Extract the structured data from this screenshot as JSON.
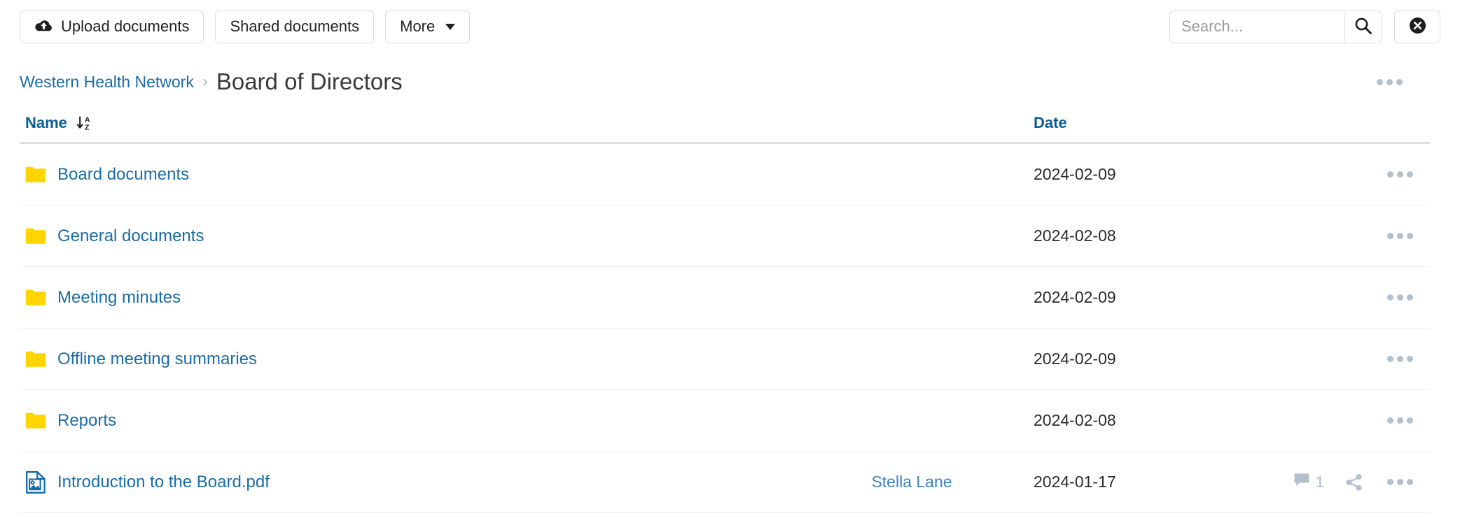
{
  "toolbar": {
    "upload_label": "Upload documents",
    "shared_label": "Shared documents",
    "more_label": "More",
    "upload_icon": "cloud-upload-icon",
    "caret_icon": "caret-down-icon"
  },
  "search": {
    "placeholder": "Search...",
    "value": "",
    "search_icon": "magnifier-icon",
    "clear_icon": "close-circle-icon"
  },
  "breadcrumb": {
    "root": "Western Health Network",
    "separator": "›",
    "current": "Board of Directors",
    "menu_icon": "ellipsis-icon"
  },
  "table": {
    "columns": {
      "name": "Name",
      "date": "Date",
      "sort_icon": "sort-alpha-asc-icon"
    },
    "rows": [
      {
        "icon": "folder-icon",
        "type": "folder",
        "name": "Board documents",
        "owner": "",
        "date": "2024-02-09",
        "comments": "",
        "shared": false
      },
      {
        "icon": "folder-icon",
        "type": "folder",
        "name": "General documents",
        "owner": "",
        "date": "2024-02-08",
        "comments": "",
        "shared": false
      },
      {
        "icon": "folder-icon",
        "type": "folder",
        "name": "Meeting minutes",
        "owner": "",
        "date": "2024-02-09",
        "comments": "",
        "shared": false
      },
      {
        "icon": "folder-icon",
        "type": "folder",
        "name": "Offline meeting summaries",
        "owner": "",
        "date": "2024-02-09",
        "comments": "",
        "shared": false
      },
      {
        "icon": "folder-icon",
        "type": "folder",
        "name": "Reports",
        "owner": "",
        "date": "2024-02-08",
        "comments": "",
        "shared": false
      },
      {
        "icon": "file-image-icon",
        "type": "file",
        "name": "Introduction to the Board.pdf",
        "owner": "Stella Lane",
        "date": "2024-01-17",
        "comments": "1",
        "shared": true
      }
    ]
  },
  "colors": {
    "link_blue": "#1a6ca8",
    "header_blue": "#0a5e94",
    "owner_blue": "#3c81c4",
    "folder_yellow": "#ffd500",
    "icon_gray": "#b3c1cd",
    "border_gray": "#dcdcdc"
  }
}
